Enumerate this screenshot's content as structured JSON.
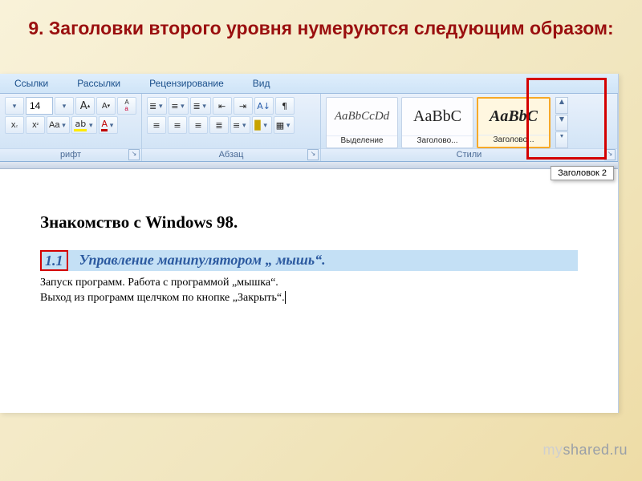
{
  "slide": {
    "title": "9. Заголовки второго уровня нумеруются следующим образом:"
  },
  "tabs": {
    "items": [
      "Ссылки",
      "Рассылки",
      "Рецензирование",
      "Вид"
    ]
  },
  "font_group": {
    "label": "рифт",
    "size": "14",
    "grow_tip": "A",
    "shrink_tip": "A",
    "clear_tip": "Aa"
  },
  "paragraph_group": {
    "label": "Абзац"
  },
  "styles_group": {
    "label": "Стили",
    "items": [
      {
        "sample": "AaBbCcDd",
        "name": "Выделение"
      },
      {
        "sample": "AaBbC",
        "name": "Заголово..."
      },
      {
        "sample": "AaBbC",
        "name": "Заголово..."
      }
    ],
    "tooltip": "Заголовок 2"
  },
  "document": {
    "chapter_title": "Знакомство с Windows 98.",
    "heading_number": "1.1",
    "heading_text": "Управление манипулятором „ мышь“.",
    "body_line1": "Запуск программ. Работа с программой „мышка“.",
    "body_line2": "Выход из программ щелчком по кнопке „Закрыть“."
  },
  "watermark": {
    "my": "my",
    "shared": "shared",
    "suffix": ".ru"
  }
}
